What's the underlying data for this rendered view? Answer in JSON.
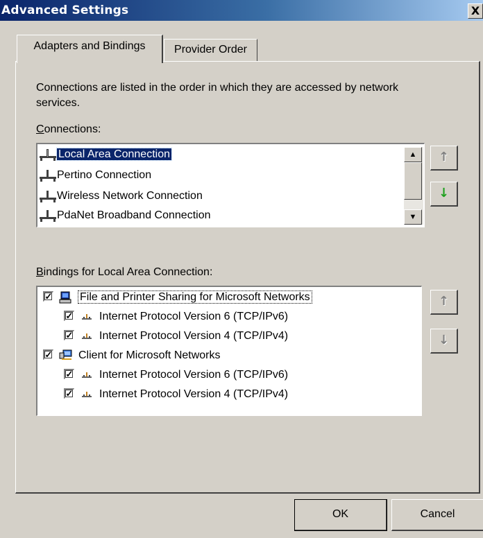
{
  "window": {
    "title": "Advanced Settings",
    "close_label": "X"
  },
  "tabs": [
    {
      "label": "Adapters and Bindings",
      "active": true
    },
    {
      "label": "Provider Order",
      "active": false
    }
  ],
  "description": "Connections are listed in the order in which they are accessed by network services.",
  "connections": {
    "label_accel": "C",
    "label_rest": "onnections:",
    "items": [
      {
        "label": "Local Area Connection",
        "selected": true,
        "icon": "network-connection-icon"
      },
      {
        "label": "Pertino Connection",
        "selected": false,
        "icon": "network-connection-icon"
      },
      {
        "label": "Wireless Network Connection",
        "selected": false,
        "icon": "network-connection-icon"
      },
      {
        "label": "PdaNet Broadband Connection",
        "selected": false,
        "icon": "network-connection-icon"
      }
    ],
    "move_up_enabled": false,
    "move_down_enabled": true
  },
  "bindings": {
    "label_accel": "B",
    "label_rest": "indings for Local Area Connection:",
    "items": [
      {
        "label": "File and Printer Sharing for Microsoft Networks",
        "checked": true,
        "level": 0,
        "icon": "file-printer-sharing-icon",
        "focused": true
      },
      {
        "label": "Internet Protocol Version 6 (TCP/IPv6)",
        "checked": true,
        "level": 1,
        "icon": "protocol-icon"
      },
      {
        "label": "Internet Protocol Version 4 (TCP/IPv4)",
        "checked": true,
        "level": 1,
        "icon": "protocol-icon"
      },
      {
        "label": "Client for Microsoft Networks",
        "checked": true,
        "level": 0,
        "icon": "network-client-icon"
      },
      {
        "label": "Internet Protocol Version 6 (TCP/IPv6)",
        "checked": true,
        "level": 1,
        "icon": "protocol-icon"
      },
      {
        "label": "Internet Protocol Version 4 (TCP/IPv4)",
        "checked": true,
        "level": 1,
        "icon": "protocol-icon"
      }
    ],
    "move_up_enabled": false,
    "move_down_enabled": false
  },
  "buttons": {
    "ok": "OK",
    "cancel": "Cancel"
  },
  "colors": {
    "titlebar_start": "#0a246a",
    "titlebar_end": "#a6caf0",
    "face": "#d4d0c8",
    "selection": "#0a246a",
    "move_down_arrow": "#1ea01e"
  }
}
